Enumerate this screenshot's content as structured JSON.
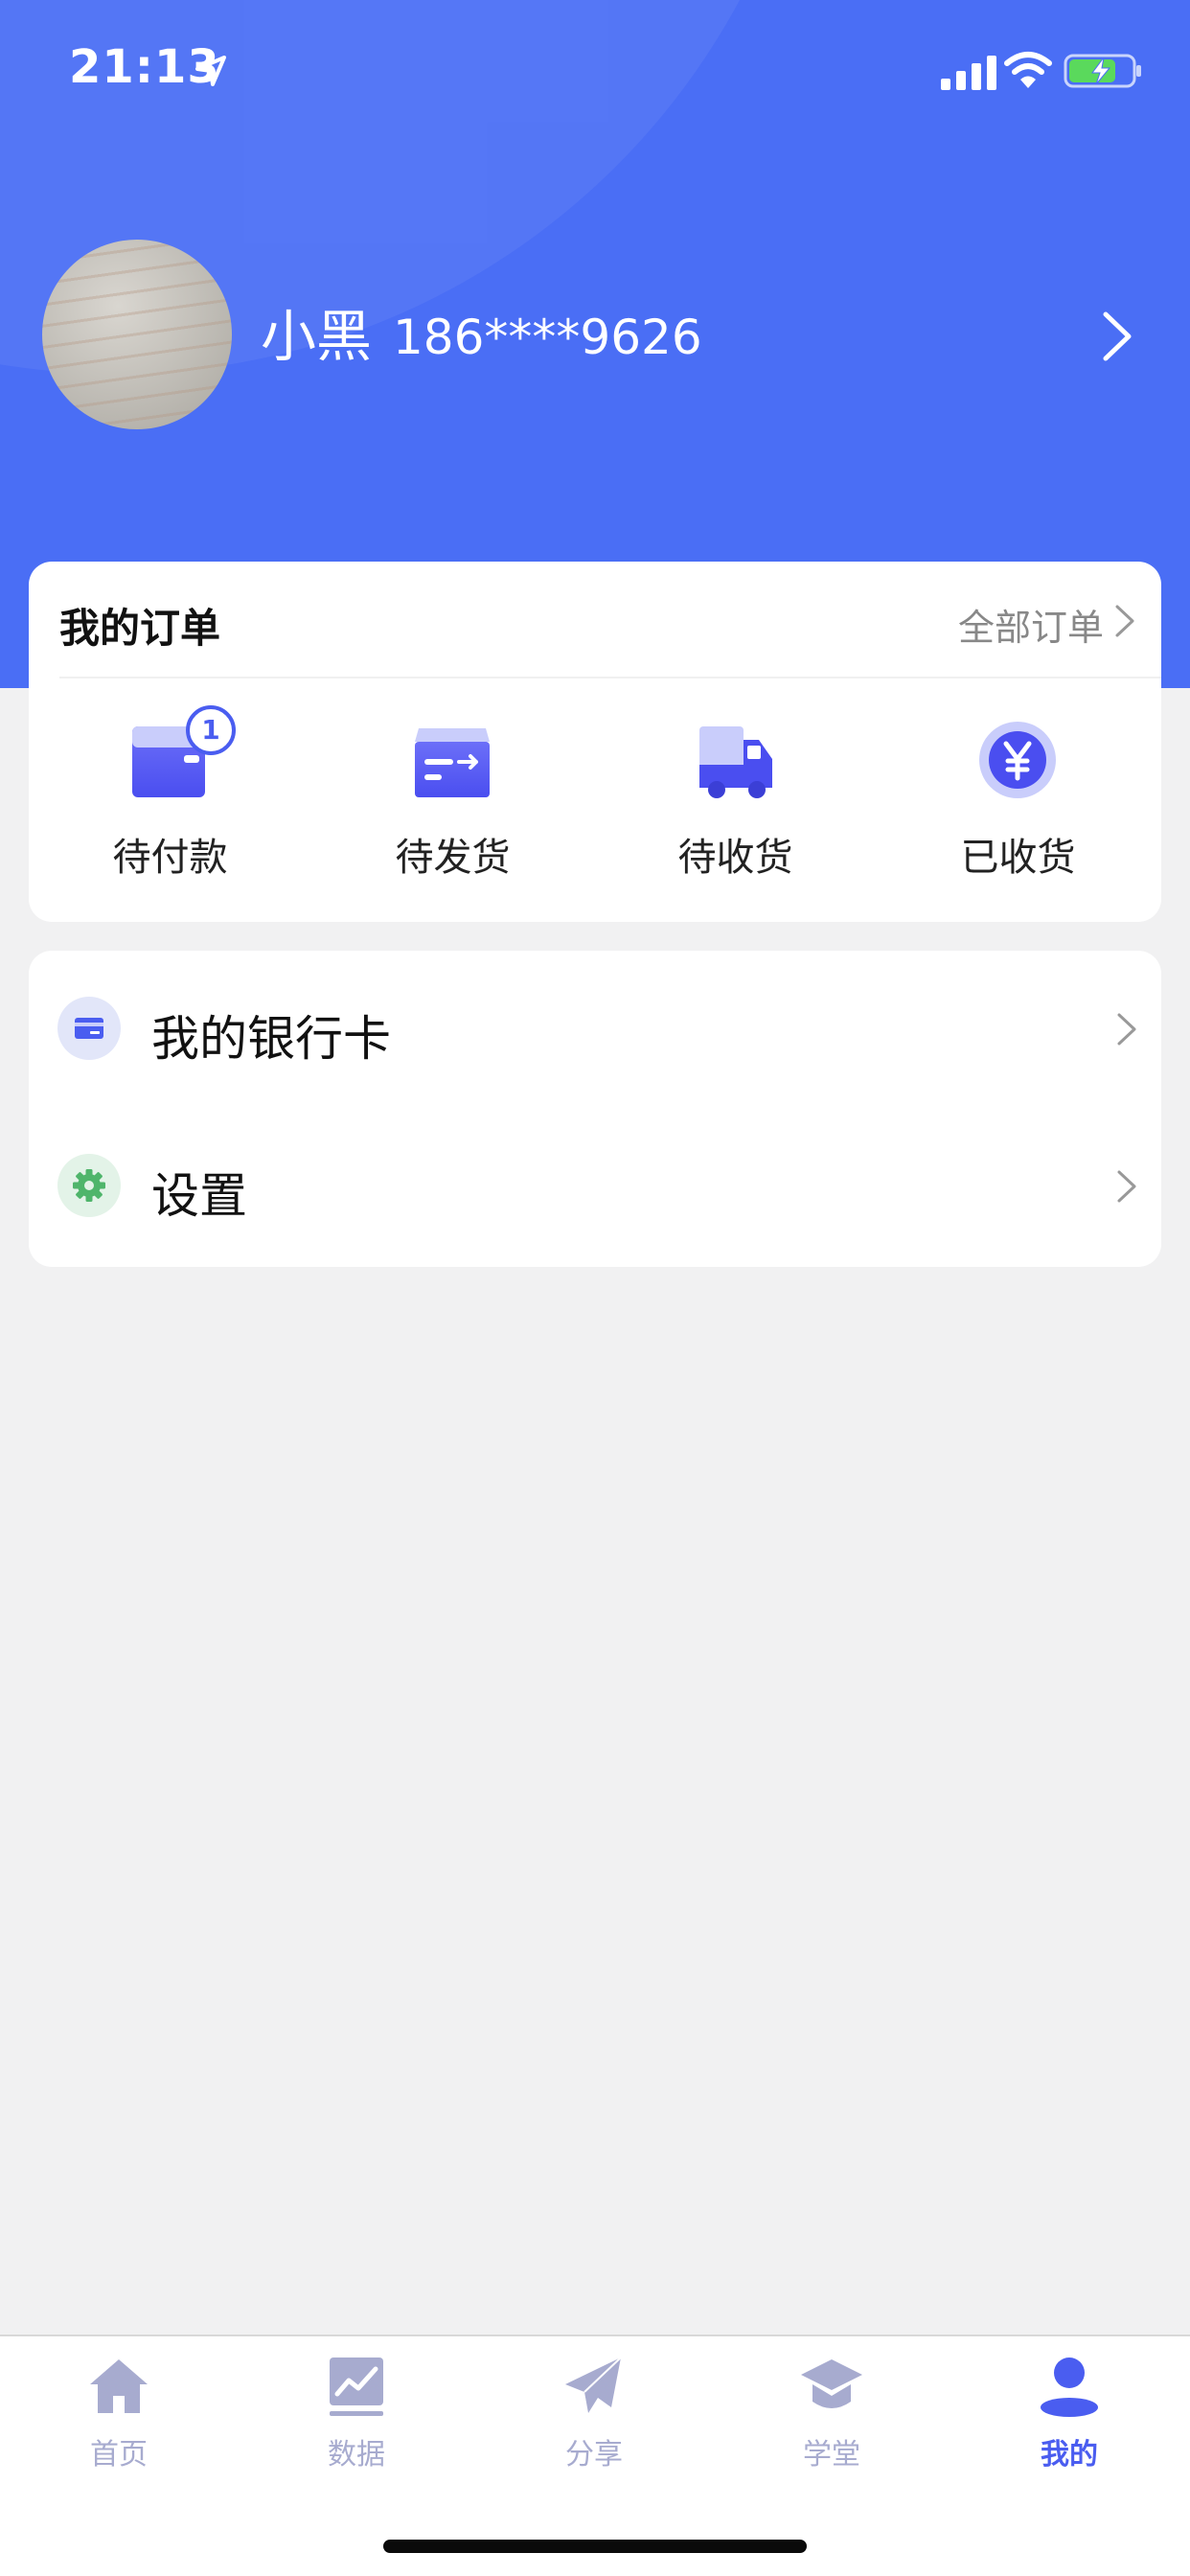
{
  "status_bar": {
    "time": "21:13"
  },
  "profile": {
    "name": "小黑",
    "phone": "186****9626"
  },
  "orders": {
    "title": "我的订单",
    "all_link": "全部订单",
    "items": [
      {
        "label": "待付款",
        "icon": "wallet-icon",
        "badge": "1"
      },
      {
        "label": "待发货",
        "icon": "package-send-icon"
      },
      {
        "label": "待收货",
        "icon": "truck-icon"
      },
      {
        "label": "已收货",
        "icon": "yuan-coin-icon"
      }
    ]
  },
  "menu": [
    {
      "label": "我的银行卡",
      "icon": "bank-card-icon"
    },
    {
      "label": "设置",
      "icon": "gear-icon"
    }
  ],
  "tabbar": [
    {
      "label": "首页",
      "icon": "home-icon"
    },
    {
      "label": "数据",
      "icon": "chart-icon"
    },
    {
      "label": "分享",
      "icon": "paper-plane-icon"
    },
    {
      "label": "学堂",
      "icon": "graduation-cap-icon"
    },
    {
      "label": "我的",
      "icon": "user-icon",
      "active": true
    }
  ],
  "colors": {
    "header": "#4a6ef5",
    "accent": "#4a5df0",
    "tab_inactive": "#a7abcf",
    "page_bg": "#f1f1f2"
  }
}
